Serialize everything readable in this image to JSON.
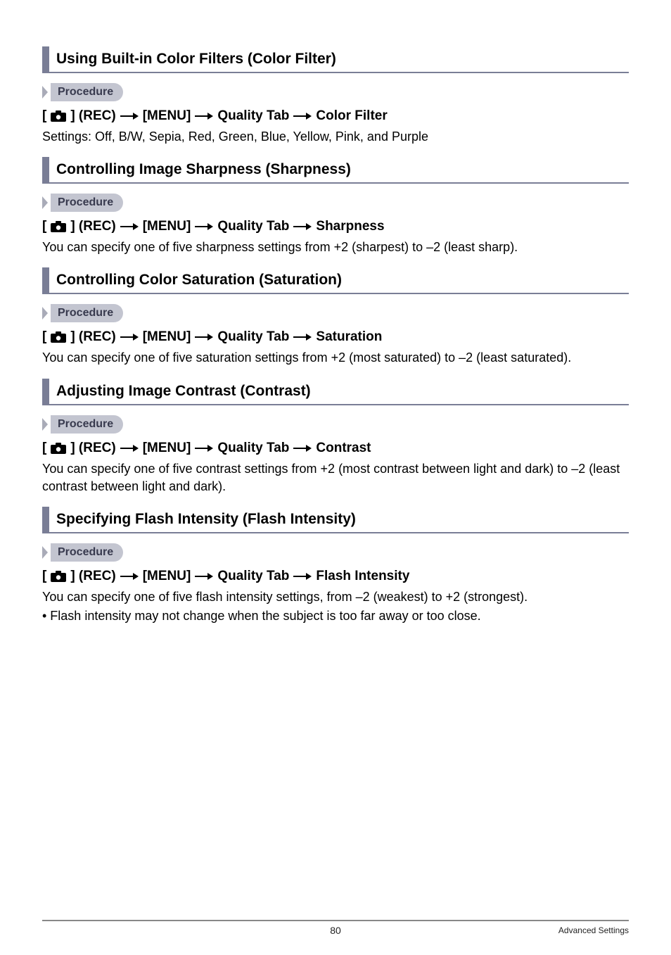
{
  "procedure_label": "Procedure",
  "camera_label": "] (REC)",
  "menu_label": "[MENU]",
  "quality_tab": "Quality Tab",
  "sections": {
    "s1": {
      "title": "Using Built-in Color Filters (Color Filter)",
      "path_end": "Color Filter",
      "body": "Settings: Off, B/W, Sepia, Red, Green, Blue, Yellow, Pink, and Purple"
    },
    "s2": {
      "title": "Controlling Image Sharpness (Sharpness)",
      "path_end": "Sharpness",
      "body": "You can specify one of five sharpness settings from +2 (sharpest) to –2 (least sharp)."
    },
    "s3": {
      "title": "Controlling Color Saturation (Saturation)",
      "path_end": "Saturation",
      "body": "You can specify one of five saturation settings from +2 (most saturated) to –2 (least saturated)."
    },
    "s4": {
      "title": "Adjusting Image Contrast (Contrast)",
      "path_end": "Contrast",
      "body": "You can specify one of five contrast settings from +2 (most contrast between light and dark) to –2 (least contrast between light and dark)."
    },
    "s5": {
      "title": "Specifying Flash Intensity (Flash Intensity)",
      "path_end": "Flash Intensity",
      "body": "You can specify one of five flash intensity settings, from –2 (weakest) to +2 (strongest).",
      "bullet": "• Flash intensity may not change when the subject is too far away or too close."
    }
  },
  "footer": {
    "page": "80",
    "text": "Advanced Settings"
  }
}
